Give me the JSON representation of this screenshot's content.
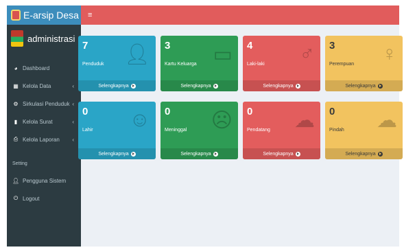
{
  "app": {
    "title": "E-arsip Desa"
  },
  "user": {
    "name": "administrasi"
  },
  "sidebar": {
    "items": [
      {
        "label": "Dashboard",
        "icon": "dashboard-icon"
      },
      {
        "label": "Kelola Data",
        "icon": "table-icon",
        "arrow": "‹"
      },
      {
        "label": "Sirkulasi Penduduk",
        "icon": "cogs-icon",
        "arrow": "‹"
      },
      {
        "label": "Kelola Surat",
        "icon": "file-icon",
        "arrow": "‹"
      },
      {
        "label": "Kelola Laporan",
        "icon": "print-icon",
        "arrow": "‹"
      }
    ],
    "section_header": "Setting",
    "settings": [
      {
        "label": "Pengguna Sistem",
        "icon": "user-icon"
      },
      {
        "label": "Logout",
        "icon": "power-icon"
      }
    ]
  },
  "topbar": {
    "menu_icon": "≡"
  },
  "cards": [
    {
      "value": "7",
      "label": "Penduduk",
      "link": "Selengkapnya",
      "icon": "user-icon",
      "color": "#2aa5c7"
    },
    {
      "value": "3",
      "label": "Kartu Keluarga",
      "link": "Selengkapnya",
      "icon": "id-card-icon",
      "color": "#2e9c55"
    },
    {
      "value": "4",
      "label": "Laki-laki",
      "link": "Selengkapnya",
      "icon": "male-icon",
      "color": "#e35d5d"
    },
    {
      "value": "3",
      "label": "Perempuan",
      "link": "Selengkapnya",
      "icon": "female-icon",
      "color": "#f2c35f"
    },
    {
      "value": "0",
      "label": "Lahir",
      "link": "Selengkapnya",
      "icon": "smile-icon",
      "color": "#2aa5c7"
    },
    {
      "value": "0",
      "label": "Meninggal",
      "link": "Selengkapnya",
      "icon": "frown-icon",
      "color": "#2e9c55"
    },
    {
      "value": "0",
      "label": "Pendatang",
      "link": "Selengkapnya",
      "icon": "cloud-download-icon",
      "color": "#e35d5d"
    },
    {
      "value": "0",
      "label": "Pindah",
      "link": "Selengkapnya",
      "icon": "cloud-upload-icon",
      "color": "#f2c35f"
    }
  ]
}
